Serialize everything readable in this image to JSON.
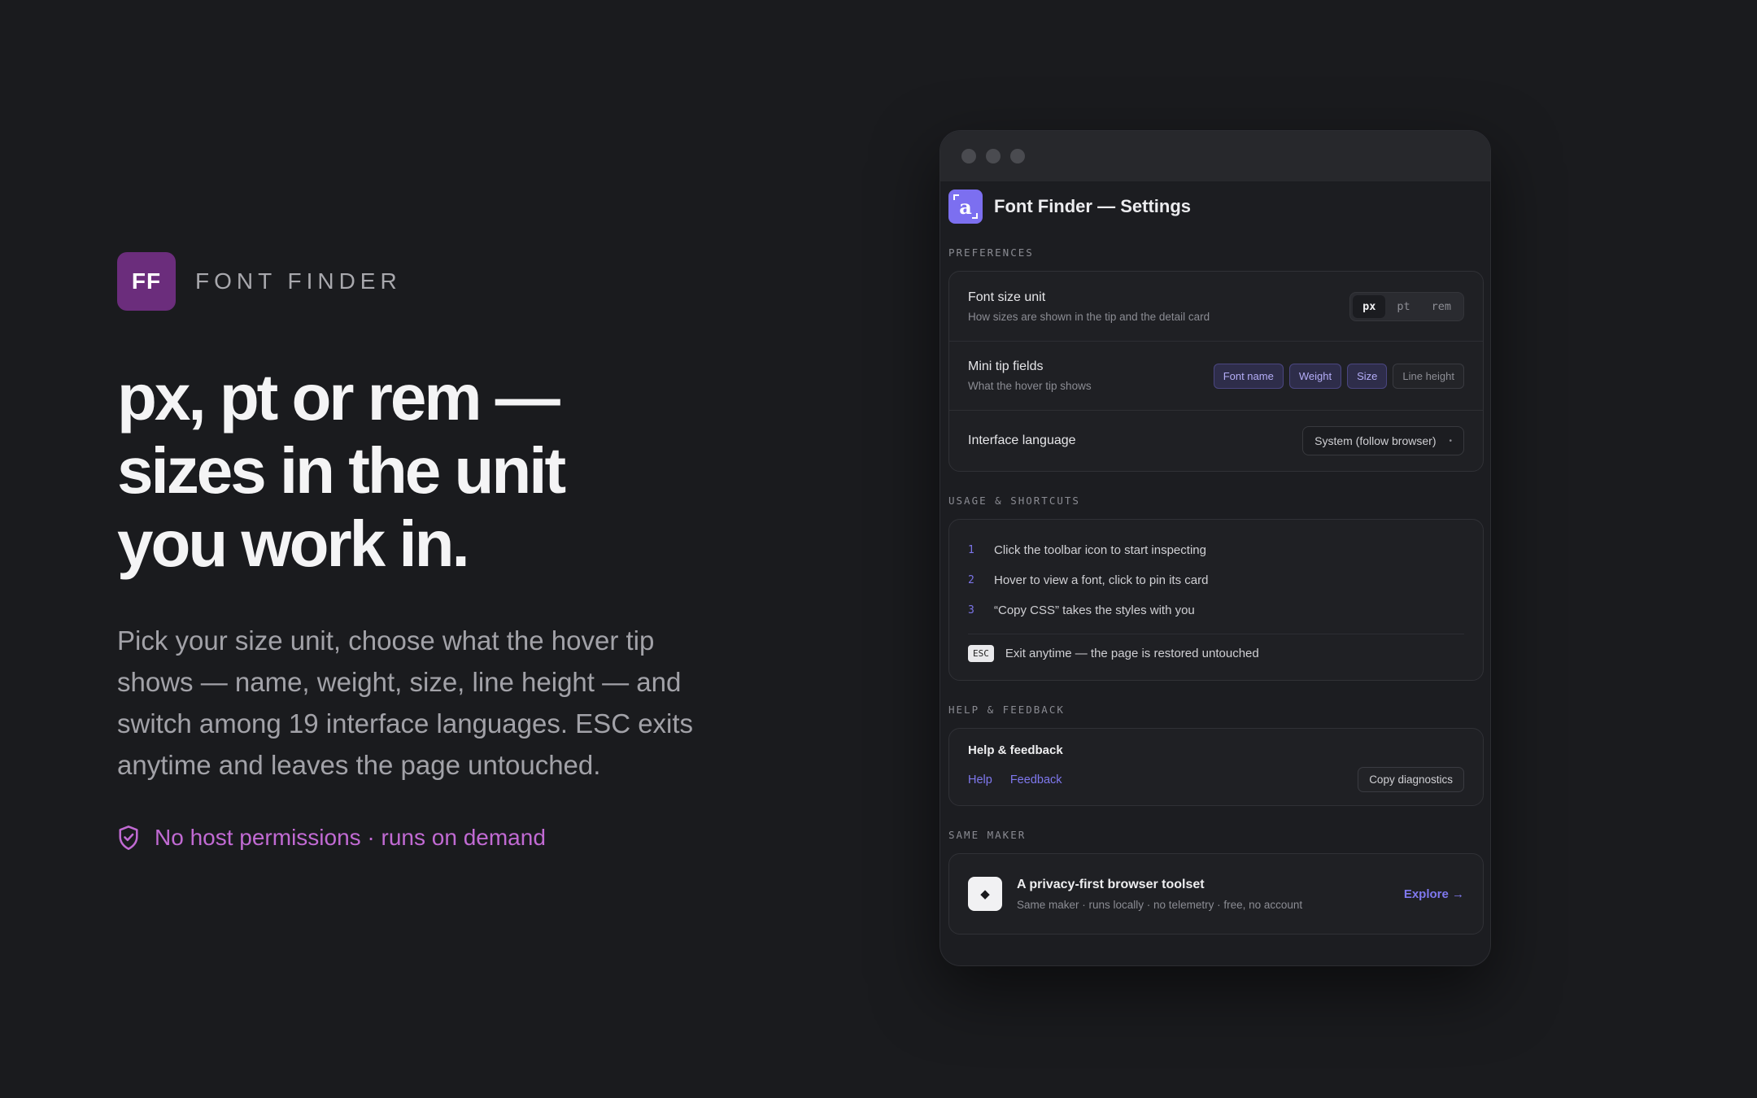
{
  "hero": {
    "logo_text": "FF",
    "brand_name": "FONT FINDER",
    "headline": "px, pt or rem —\nsizes in the unit\nyou work in.",
    "lede": "Pick your size unit, choose what the hover tip shows — name, weight, size, line height — and switch among 19 interface languages. ESC exits anytime and leaves the page untouched.",
    "permission_note": "No host permissions · runs on demand",
    "permission_icon": "shield-check-icon"
  },
  "window": {
    "app_icon_letter": "a",
    "app_title": "Font Finder — Settings",
    "preferences": {
      "label": "PREFERENCES",
      "font_size_unit": {
        "title": "Font size unit",
        "subtitle": "How sizes are shown in the tip and the detail card",
        "options": [
          "px",
          "pt",
          "rem"
        ],
        "selected": "px"
      },
      "mini_tip": {
        "title": "Mini tip fields",
        "subtitle": "What the hover tip shows",
        "fields": [
          {
            "label": "Font name",
            "on": true
          },
          {
            "label": "Weight",
            "on": true
          },
          {
            "label": "Size",
            "on": true
          },
          {
            "label": "Line height",
            "on": false
          }
        ]
      },
      "language": {
        "title": "Interface language",
        "value": "System (follow browser)"
      }
    },
    "usage": {
      "label": "USAGE & SHORTCUTS",
      "steps": [
        {
          "num": "1",
          "text": "Click the toolbar icon to start inspecting"
        },
        {
          "num": "2",
          "text": "Hover to view a font, click to pin its card"
        },
        {
          "num": "3",
          "text": "“Copy CSS” takes the styles with you"
        }
      ],
      "esc_key": "ESC",
      "esc_text": "Exit anytime — the page is restored untouched"
    },
    "help": {
      "label": "HELP & FEEDBACK",
      "title": "Help & feedback",
      "help_link": "Help",
      "feedback_link": "Feedback",
      "copy_button": "Copy diagnostics"
    },
    "maker": {
      "label": "SAME MAKER",
      "title": "A privacy-first browser toolset",
      "subtitle": "Same maker · runs locally · no telemetry · free, no account",
      "explore": "Explore →"
    }
  },
  "colors": {
    "background": "#1a1b1e",
    "brand_logo": "#6b2d7c",
    "accent_purple": "#c16ad3",
    "accent_link": "#7f78ee",
    "app_icon": "#7c6ff0"
  }
}
